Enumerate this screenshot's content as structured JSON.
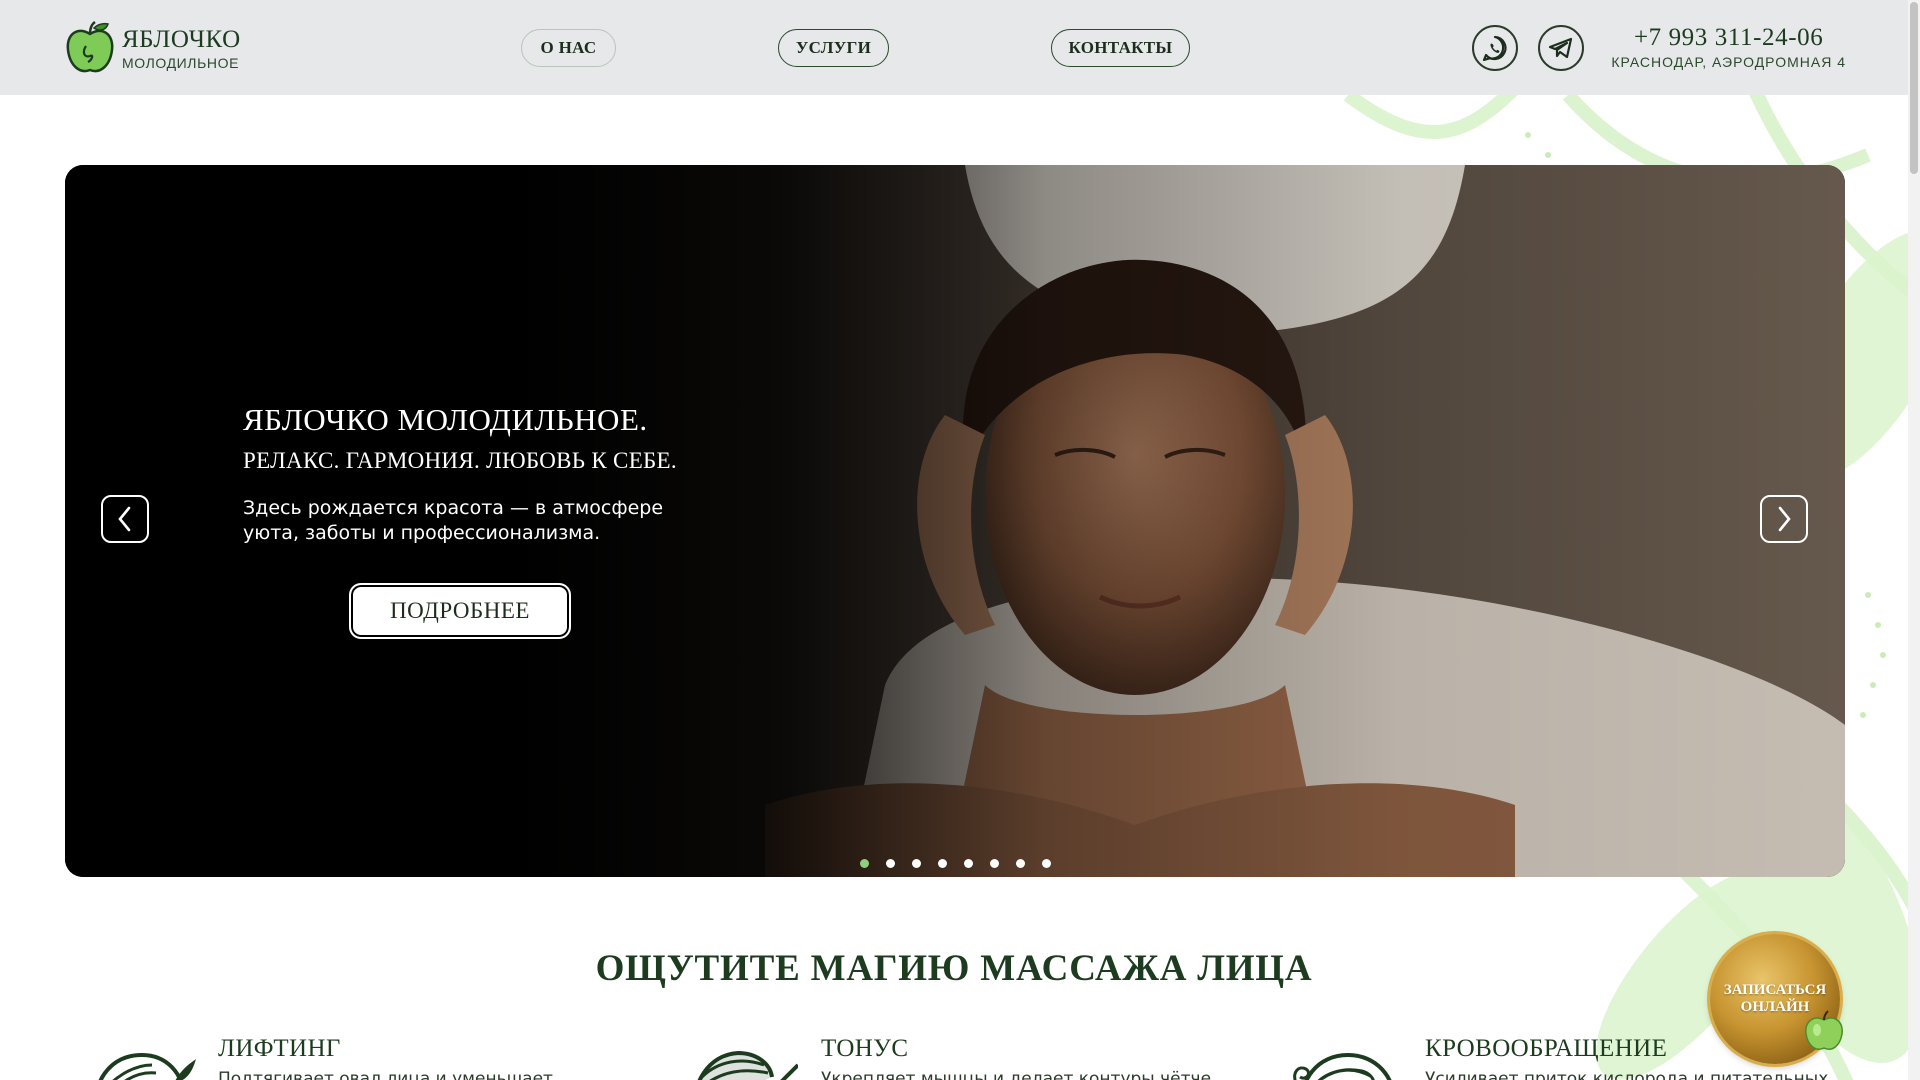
{
  "header": {
    "logo_title": "ЯБЛОЧКО",
    "logo_subtitle": "МОЛОДИЛЬНОЕ",
    "nav": [
      {
        "label": "О НАС"
      },
      {
        "label": "УСЛУГИ"
      },
      {
        "label": "КОНТАКТЫ"
      }
    ],
    "social": [
      {
        "icon": "whatsapp-icon"
      },
      {
        "icon": "telegram-icon"
      }
    ],
    "phone": "+7 993 311-24-06",
    "address": "КРАСНОДАР,  АЭРОДРОМНАЯ  4"
  },
  "hero": {
    "title": "ЯБЛОЧКО МОЛОДИЛЬНОЕ.",
    "subtitle": "РЕЛАКС. ГАРМОНИЯ. ЛЮБОВЬ К СЕБЕ.",
    "description": "Здесь рождается красота — в атмосфере уюта, заботы и профессионализма.",
    "button_label": "ПОДРОБНЕЕ",
    "slide_count": 8,
    "active_slide": 0,
    "active_dot_color": "#8fd07f"
  },
  "section": {
    "title": "ОЩУТИТЕ МАГИЮ МАССАЖА ЛИЦА",
    "features": [
      {
        "title": "ЛИФТИНГ",
        "description": "Подтягивает овал лица и уменьшает",
        "icon": "face-leaves-icon"
      },
      {
        "title": "ТОНУС",
        "description": "Укрепляет мышцы и делает контуры чётче",
        "icon": "face-profile-icon"
      },
      {
        "title": "КРОВООБРАЩЕНИЕ",
        "description": "Усиливает приток кислорода и питательных",
        "icon": "face-swirl-icon"
      }
    ]
  },
  "book_button": {
    "label": "ЗАПИСАТЬСЯ ОНЛАЙН"
  },
  "colors": {
    "brand_green": "#1d3b1f",
    "accent_green": "#8fd07f",
    "header_bg": "#e6e8ea",
    "gold": "#c79430"
  }
}
